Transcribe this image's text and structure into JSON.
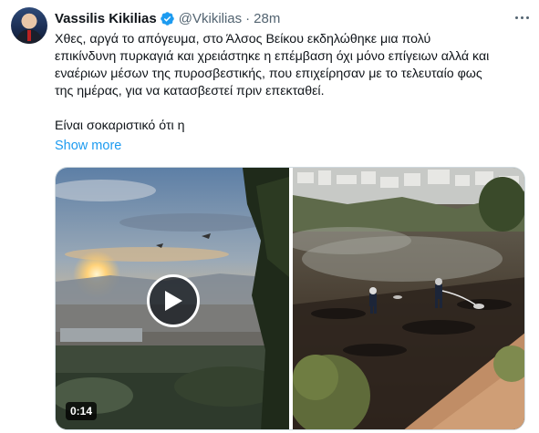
{
  "tweet": {
    "author_name": "Vassilis Kikilias",
    "handle": "@Vkikilias",
    "separator": "·",
    "time": "28m",
    "text": "Χθες, αργά το απόγευμα, στο Άλσος Βείκου εκδηλώθηκε μια πολύ\nεπικίνδυνη πυρκαγιά και χρειάστηκε η επέμβαση όχι μόνο επίγειων αλλά και\nεναέριων μέσων της πυροσβεστικής, που επιχείρησαν με το τελευταίο φως\nτης ημέρας, για να κατασβεστεί πριν επεκταθεί.\n\nΕίναι σοκαριστικό ότι η",
    "show_more": "Show more",
    "verified": true
  },
  "media": {
    "video_duration": "0:14",
    "video_description_icon": "play-icon"
  },
  "colors": {
    "link": "#1d9bf0",
    "secondary_text": "#536471",
    "verified_badge": "#1d9bf0"
  }
}
